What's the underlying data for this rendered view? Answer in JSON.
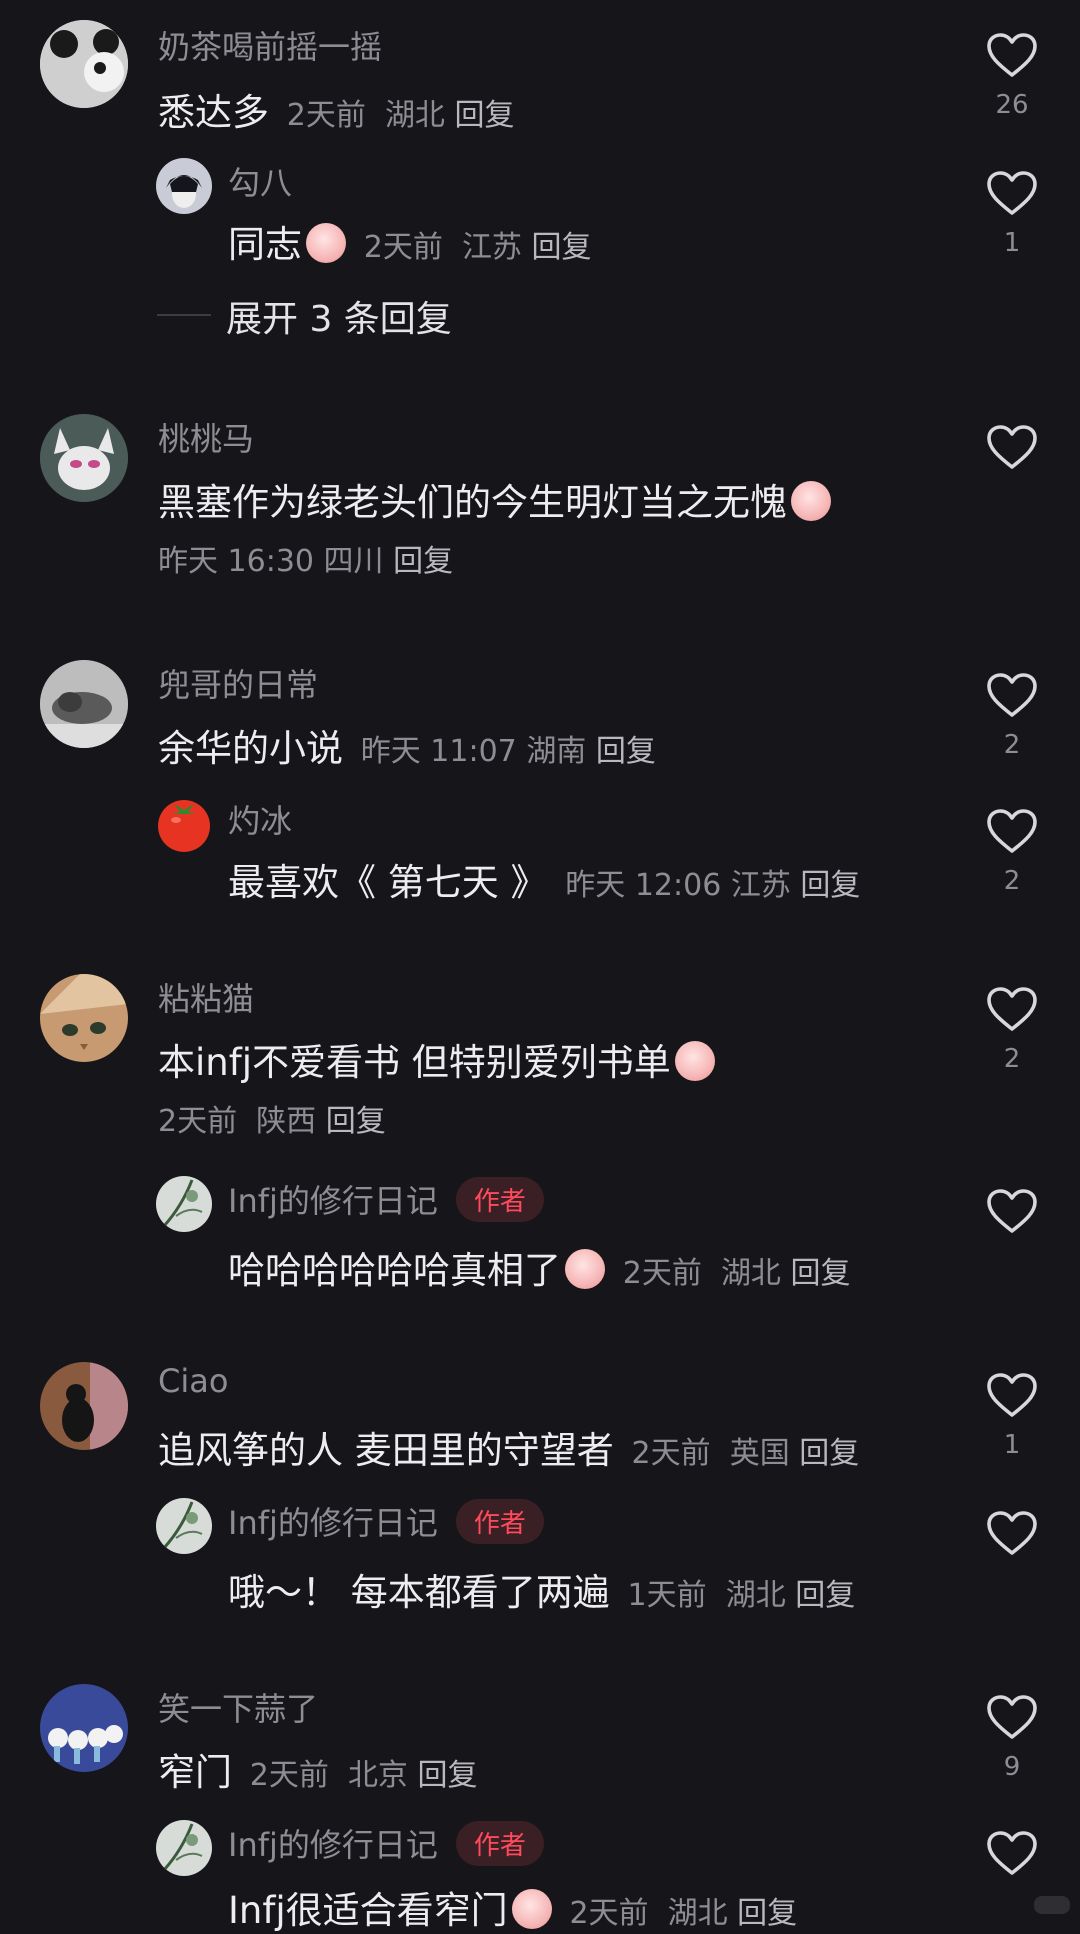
{
  "comments": [
    {
      "name": "奶茶喝前摇一摇",
      "text": "悉达多",
      "meta": [
        "2天前",
        "湖北"
      ],
      "reply_label": "回复",
      "likes": "26",
      "avatar_icon": "panda-avatar-icon",
      "replies": [
        {
          "name": "勾八",
          "text": "同志",
          "emoji": "blush-face-emoji-icon",
          "meta": [
            "2天前",
            "江苏"
          ],
          "reply_label": "回复",
          "likes": "1",
          "avatar_icon": "anime-boy-avatar-icon"
        }
      ],
      "expand_label": "展开 3 条回复"
    },
    {
      "name": "桃桃马",
      "text": "黑塞作为绿老头们的今生明灯当之无愧",
      "emoji": "pray-face-emoji-icon",
      "meta": [
        "昨天 16:30",
        "四川"
      ],
      "reply_label": "回复",
      "likes": "",
      "avatar_icon": "cartoon-cat-avatar-icon"
    },
    {
      "name": "兜哥的日常",
      "text": "余华的小说",
      "meta": [
        "昨天 11:07",
        "湖南"
      ],
      "reply_label": "回复",
      "likes": "2",
      "avatar_icon": "cat-photo-avatar-icon",
      "replies": [
        {
          "name": "灼冰",
          "text": "最喜欢《 第七天 》",
          "meta": [
            "昨天 12:06",
            "江苏"
          ],
          "reply_label": "回复",
          "likes": "2",
          "avatar_icon": "tomato-avatar-icon"
        }
      ]
    },
    {
      "name": "粘粘猫",
      "text": "本infj不爱看书 但特别爱列书单",
      "emoji": "crying-face-emoji-icon",
      "meta": [
        "2天前",
        "陕西"
      ],
      "reply_label": "回复",
      "likes": "2",
      "avatar_icon": "painted-cat-avatar-icon",
      "replies": [
        {
          "name": "Infj的修行日记",
          "tag": "作者",
          "text": "哈哈哈哈哈哈真相了",
          "emoji": "smirk-face-emoji-icon",
          "meta": [
            "2天前",
            "湖北"
          ],
          "reply_label": "回复",
          "likes": "",
          "avatar_icon": "bamboo-avatar-icon"
        }
      ]
    },
    {
      "name": "Ciao",
      "text": "追风筝的人 麦田里的守望者",
      "meta": [
        "2天前",
        "英国"
      ],
      "reply_label": "回复",
      "likes": "1",
      "avatar_icon": "black-cat-avatar-icon",
      "replies": [
        {
          "name": "Infj的修行日记",
          "tag": "作者",
          "text": "哦～！ 每本都看了两遍",
          "meta": [
            "1天前",
            "湖北"
          ],
          "reply_label": "回复",
          "likes": "",
          "avatar_icon": "bamboo-avatar-icon"
        }
      ]
    },
    {
      "name": "笑一下蒜了",
      "text": "窄门",
      "meta": [
        "2天前",
        "北京"
      ],
      "reply_label": "回复",
      "likes": "9",
      "avatar_icon": "garlic-avatar-icon",
      "replies": [
        {
          "name": "Infj的修行日记",
          "tag": "作者",
          "text": "Infj很适合看窄门",
          "emoji": "shy-face-emoji-icon",
          "meta": [
            "2天前",
            "湖北"
          ],
          "reply_label": "回复",
          "likes": "",
          "avatar_icon": "bamboo-avatar-icon"
        }
      ]
    }
  ],
  "colors": {
    "background": "#16161a",
    "secondary_text": "#8d8d93",
    "author_tag": "#ff4a5c"
  }
}
